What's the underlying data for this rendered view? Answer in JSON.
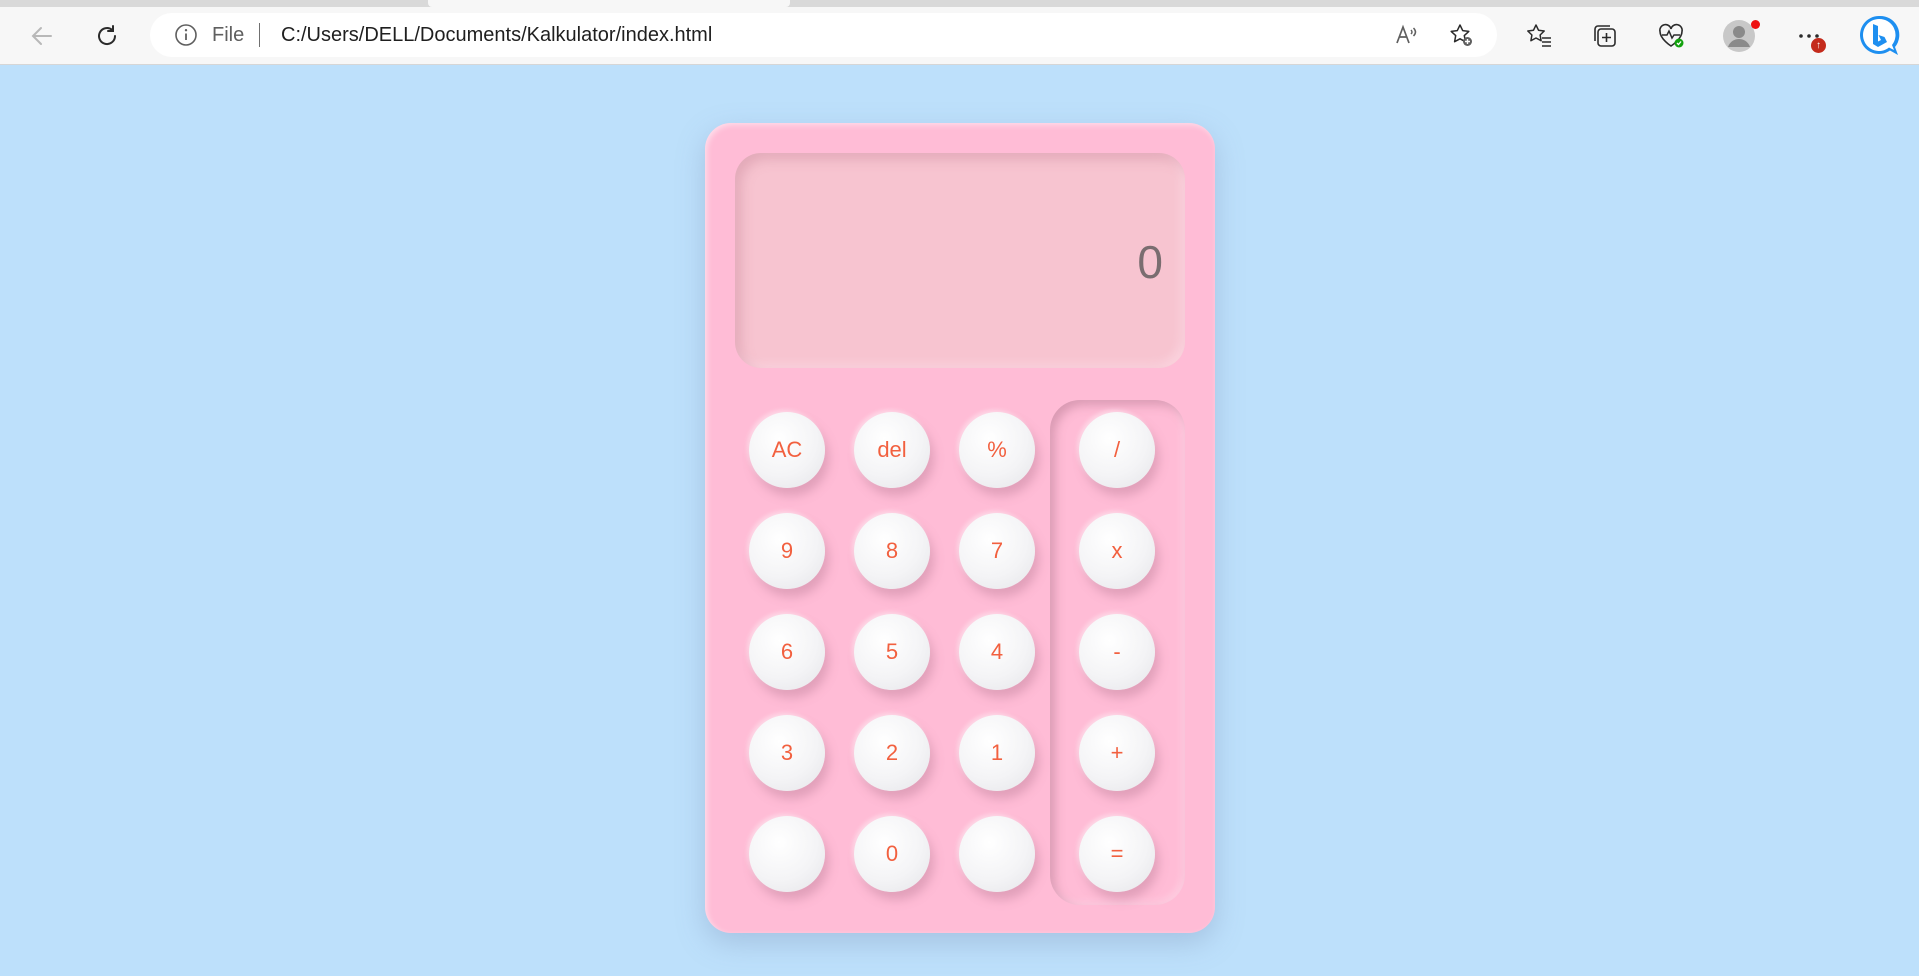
{
  "browser": {
    "address_prefix": "File",
    "url": "C:/Users/DELL/Documents/Kalkulator/index.html",
    "badge_text": "↑"
  },
  "calculator": {
    "display": "0",
    "keys": {
      "ac": "AC",
      "del": "del",
      "percent": "%",
      "nine": "9",
      "eight": "8",
      "seven": "7",
      "six": "6",
      "five": "5",
      "four": "4",
      "three": "3",
      "two": "2",
      "one": "1",
      "blank_left": "",
      "zero": "0",
      "blank_right": "",
      "divide": "/",
      "multiply": "x",
      "minus": "-",
      "plus": "+",
      "equals": "="
    }
  },
  "colors": {
    "page_background": "#bde0fb",
    "calculator_body": "#ffbcd6",
    "display_background": "#f7c4d0",
    "key_text": "#f2603f"
  }
}
